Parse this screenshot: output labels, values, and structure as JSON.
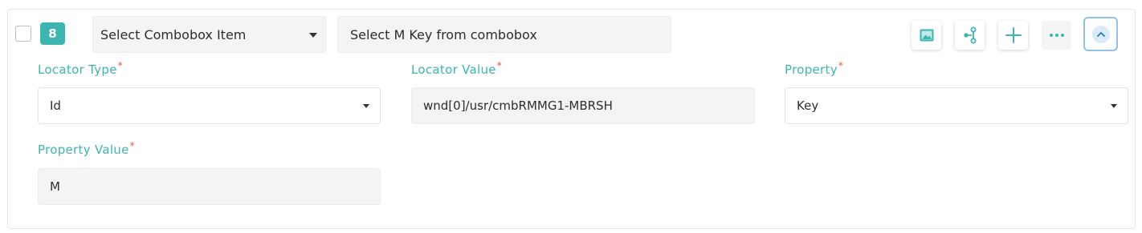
{
  "step": {
    "number": "8",
    "action": "Select Combobox Item",
    "description": "Select M Key from combobox"
  },
  "toolbar": {
    "icons": [
      "image-icon",
      "branch-icon",
      "plus-icon",
      "more-icon",
      "chevron-up-icon"
    ]
  },
  "fields": {
    "locator_type": {
      "label": "Locator Type",
      "value": "Id"
    },
    "locator_value": {
      "label": "Locator Value",
      "value": "wnd[0]/usr/cmbRMMG1-MBRSH"
    },
    "property": {
      "label": "Property",
      "value": "Key"
    },
    "property_value": {
      "label": "Property Value",
      "value": "M"
    },
    "required_mark": "*"
  },
  "colors": {
    "accent": "#3db5b0",
    "required": "#e4573d",
    "focus_border": "#8fc2e8"
  }
}
